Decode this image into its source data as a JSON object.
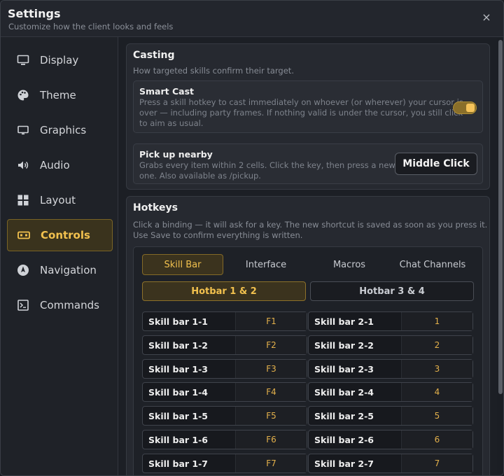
{
  "window": {
    "title": "Settings",
    "subtitle": "Customize how the client looks and feels",
    "close_label": "×"
  },
  "sidebar": {
    "items": [
      {
        "label": "Display",
        "icon": "monitor-icon"
      },
      {
        "label": "Theme",
        "icon": "palette-icon"
      },
      {
        "label": "Graphics",
        "icon": "screen-icon"
      },
      {
        "label": "Audio",
        "icon": "speaker-icon"
      },
      {
        "label": "Layout",
        "icon": "grid-icon"
      },
      {
        "label": "Controls",
        "icon": "keyboard-icon",
        "active": true
      },
      {
        "label": "Navigation",
        "icon": "compass-icon"
      },
      {
        "label": "Commands",
        "icon": "terminal-icon"
      }
    ]
  },
  "casting": {
    "title": "Casting",
    "description": "How targeted skills confirm their target.",
    "smart_cast": {
      "title": "Smart Cast",
      "description_lines": [
        "Press a skill hotkey to cast immediately on whoever (or wherever) your cursor is",
        "over — including party frames. If nothing valid is under the cursor, you still click",
        "to aim as usual."
      ],
      "enabled": true
    },
    "pickup": {
      "title": "Pick up nearby",
      "description_lines": [
        "Grabs every item within 2 cells. Click the key, then press a new",
        "one. Also available as /pickup."
      ],
      "binding": "Middle Click"
    }
  },
  "hotkeys": {
    "title": "Hotkeys",
    "description_lines": [
      "Click a binding — it will ask for a key. The new shortcut is saved as soon as you press it.",
      "Use Save to confirm everything is written."
    ],
    "tabs": [
      "Skill Bar",
      "Interface",
      "Macros",
      "Chat Channels"
    ],
    "active_tab": "Skill Bar",
    "subtabs": [
      "Hotbar 1 & 2",
      "Hotbar 3 & 4"
    ],
    "active_subtab": "Hotbar 1 & 2",
    "bindings_left": [
      {
        "name": "Skill bar 1-1",
        "key": "F1"
      },
      {
        "name": "Skill bar 1-2",
        "key": "F2"
      },
      {
        "name": "Skill bar 1-3",
        "key": "F3"
      },
      {
        "name": "Skill bar 1-4",
        "key": "F4"
      },
      {
        "name": "Skill bar 1-5",
        "key": "F5"
      },
      {
        "name": "Skill bar 1-6",
        "key": "F6"
      },
      {
        "name": "Skill bar 1-7",
        "key": "F7"
      }
    ],
    "bindings_right": [
      {
        "name": "Skill bar 2-1",
        "key": "1"
      },
      {
        "name": "Skill bar 2-2",
        "key": "2"
      },
      {
        "name": "Skill bar 2-3",
        "key": "3"
      },
      {
        "name": "Skill bar 2-4",
        "key": "4"
      },
      {
        "name": "Skill bar 2-5",
        "key": "5"
      },
      {
        "name": "Skill bar 2-6",
        "key": "6"
      },
      {
        "name": "Skill bar 2-7",
        "key": "7"
      }
    ]
  },
  "colors": {
    "accent": "#f2c14e",
    "accent_border": "#846a27",
    "background": "#1c1f25"
  }
}
